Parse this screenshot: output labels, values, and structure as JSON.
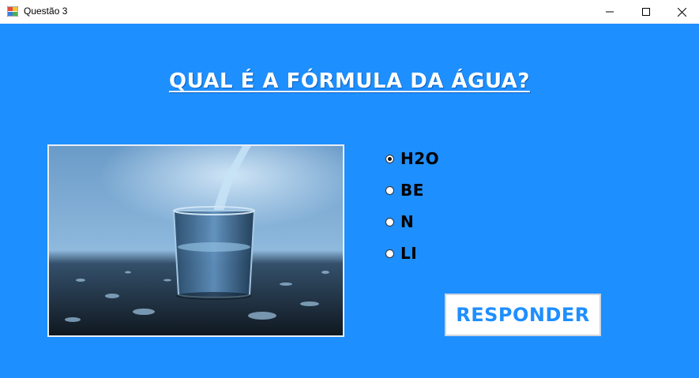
{
  "window": {
    "title": "Questão 3",
    "controls": {
      "minimize": "minimize-icon",
      "maximize": "maximize-icon",
      "close": "close-icon"
    },
    "background_color": "#1e8fff"
  },
  "question": {
    "text": "QUAL É A FÓRMULA DA ÁGUA?"
  },
  "image": {
    "subject": "water-glass-photo"
  },
  "options": [
    {
      "label": "H2O",
      "checked": true
    },
    {
      "label": "BE",
      "checked": false
    },
    {
      "label": "N",
      "checked": false
    },
    {
      "label": "LI",
      "checked": false
    }
  ],
  "submit": {
    "label": "RESPONDER",
    "color": "#1e8fff"
  }
}
